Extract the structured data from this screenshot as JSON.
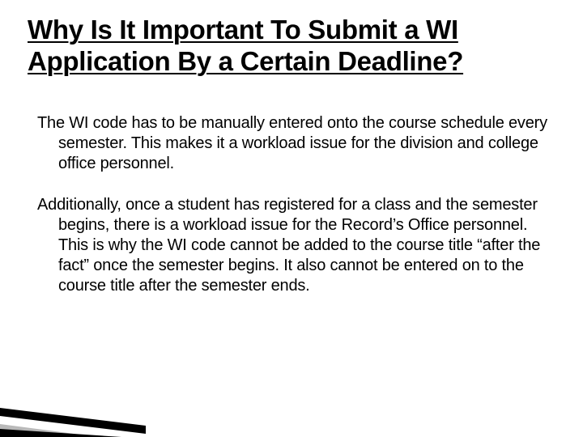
{
  "slide": {
    "title": "Why Is It Important To Submit a WI Application By a Certain Deadline?",
    "paragraph1": "The WI code has to be manually entered onto the course schedule every semester.  This makes it a workload issue for the division and college office personnel.",
    "paragraph2": "Additionally, once a student has registered for a class and the semester begins, there is a workload issue for the Record’s Office personnel.  This is why the WI code cannot be added to the course title “after the fact” once the semester begins.  It also cannot be entered on to the course title after the semester ends."
  }
}
